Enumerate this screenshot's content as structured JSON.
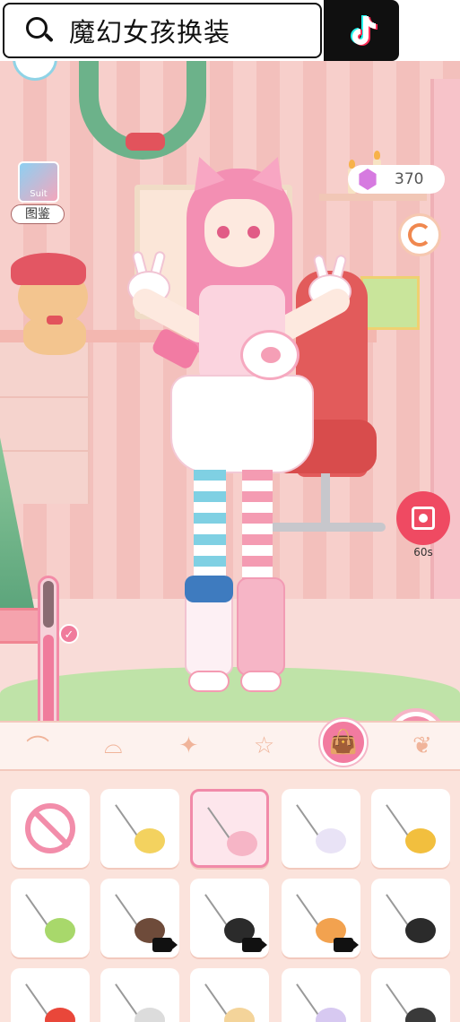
{
  "search": {
    "query": "魔幻女孩换装"
  },
  "hud": {
    "suit_icon_text": "Suit",
    "suit_label": "图鉴",
    "coins": "370",
    "record_time": "60s",
    "slider_check": "✓"
  },
  "tabs": [
    {
      "name": "hair-accessory-icon",
      "glyph": "⌒",
      "active": false
    },
    {
      "name": "glasses-icon",
      "glyph": "⌓",
      "active": false
    },
    {
      "name": "earrings-icon",
      "glyph": "✦",
      "active": false
    },
    {
      "name": "necklace-icon",
      "glyph": "☆",
      "active": false
    },
    {
      "name": "bag-icon",
      "glyph": "👜",
      "active": true
    },
    {
      "name": "wings-icon",
      "glyph": "❦",
      "active": false
    }
  ],
  "items": [
    {
      "name": "none-option",
      "kind": "none",
      "selected": false,
      "video": false
    },
    {
      "name": "bunny-cookie-bag",
      "color": "#f3d25f",
      "selected": false,
      "video": false
    },
    {
      "name": "paw-bag",
      "color": "#f6b5c6",
      "selected": true,
      "video": false
    },
    {
      "name": "bunny-plush-bag",
      "color": "#e9e3f6",
      "selected": false,
      "video": false
    },
    {
      "name": "yellow-pouch-bag",
      "color": "#f2bf3e",
      "selected": false,
      "video": false
    },
    {
      "name": "eyeball-bag",
      "color": "#a8d86b",
      "selected": false,
      "video": false
    },
    {
      "name": "cookie-bag",
      "color": "#6e4b3a",
      "selected": false,
      "video": true
    },
    {
      "name": "black-cat-bag",
      "color": "#2b2b2b",
      "selected": false,
      "video": true
    },
    {
      "name": "shiba-bag",
      "color": "#f2a24f",
      "selected": false,
      "video": true
    },
    {
      "name": "black-bunny-bag",
      "color": "#2b2b2b",
      "selected": false,
      "video": false
    },
    {
      "name": "fries-bag",
      "color": "#e9473a",
      "selected": false,
      "video": false
    },
    {
      "name": "white-bag",
      "color": "#dcdcdc",
      "selected": false,
      "video": false
    },
    {
      "name": "cream-bag",
      "color": "#f4d49a",
      "selected": false,
      "video": false
    },
    {
      "name": "lavender-bunny-bag",
      "color": "#d7c9f1",
      "selected": false,
      "video": false
    },
    {
      "name": "dark-bag",
      "color": "#3a3a3a",
      "selected": false,
      "video": false
    }
  ],
  "colors": {
    "accent": "#f27ba0",
    "record": "#ef4a62"
  }
}
